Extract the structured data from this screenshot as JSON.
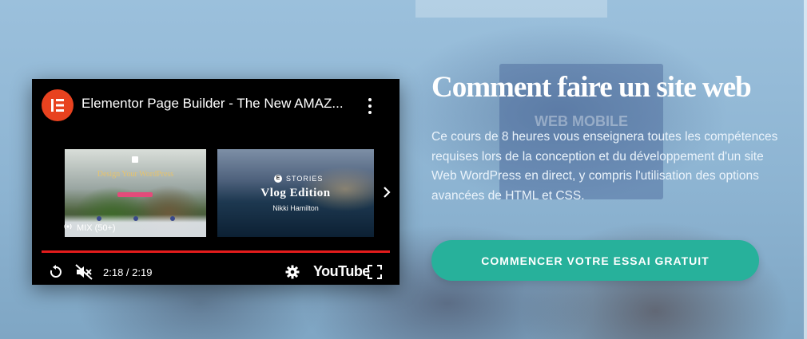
{
  "video": {
    "title": "Elementor Page Builder - The New AMAZ...",
    "channel_icon": "elementor-logo-icon",
    "menu_icon": "more-vertical-icon",
    "time": "2:18 / 2:19",
    "progress": 0.99,
    "brand": "YouTube",
    "accent_color": "#e31c1c",
    "related": [
      {
        "heading": "Design Your WordPress"
      },
      {
        "badge": "STORIES",
        "title": "Vlog Edition",
        "author": "Nikki Hamilton"
      }
    ],
    "mix_label": "MIX (50+)"
  },
  "hero": {
    "headline": "Comment faire un site web",
    "description": "Ce cours de 8 heures vous enseignera toutes les compétences requises lors de la conception et du développement d'un site Web WordPress en direct, y compris l'utilisation des options avancées de HTML et CSS.",
    "cta_label": "COMMENCER VOTRE ESSAI GRATUIT",
    "cta_color": "#27b19b"
  }
}
